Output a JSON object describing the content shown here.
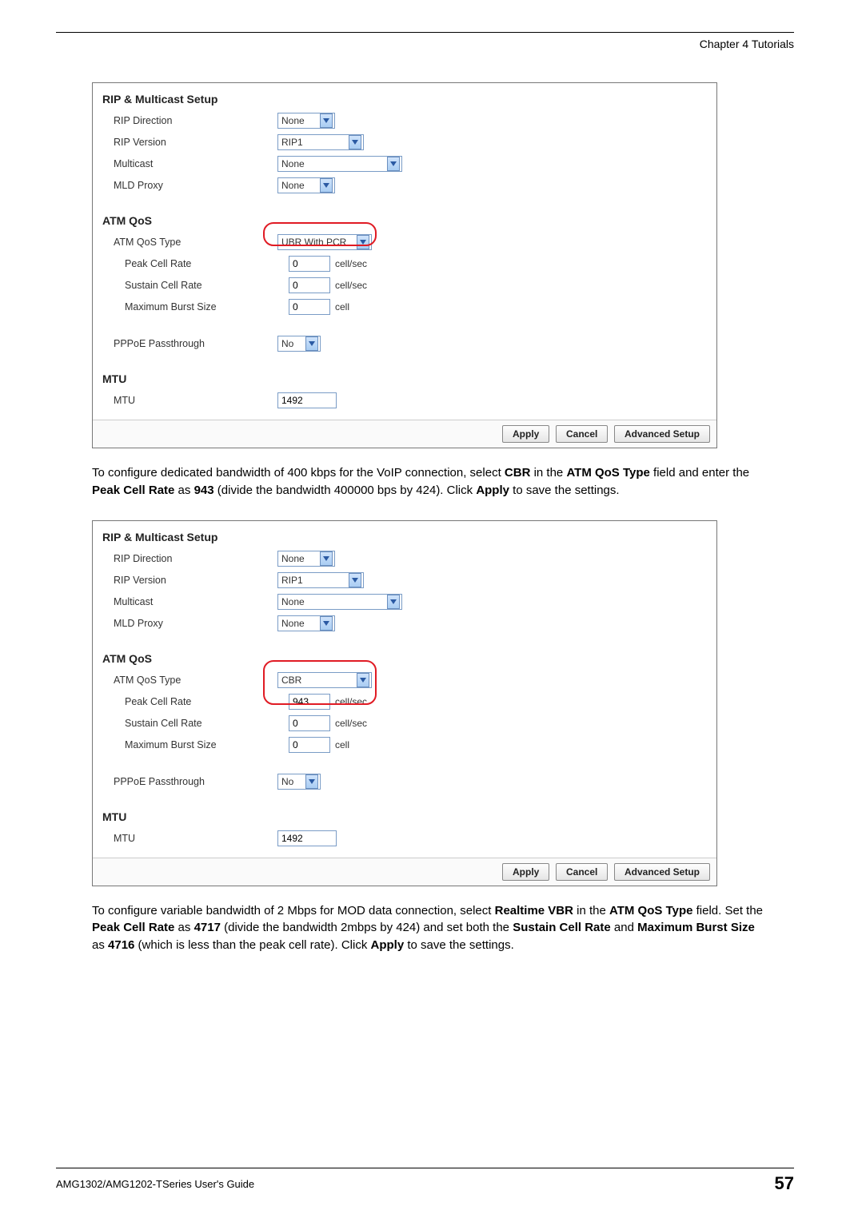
{
  "header": {
    "chapter": "Chapter 4 Tutorials"
  },
  "panel1": {
    "sectionA": "RIP & Multicast Setup",
    "ripDirection": {
      "label": "RIP Direction",
      "value": "None"
    },
    "ripVersion": {
      "label": "RIP Version",
      "value": "RIP1"
    },
    "multicast": {
      "label": "Multicast",
      "value": "None"
    },
    "mldProxy": {
      "label": "MLD Proxy",
      "value": "None"
    },
    "sectionB": "ATM QoS",
    "atmQosType": {
      "label": "ATM QoS Type",
      "value": "UBR With PCR"
    },
    "peak": {
      "label": "Peak Cell Rate",
      "value": "0",
      "unit": "cell/sec"
    },
    "sustain": {
      "label": "Sustain Cell Rate",
      "value": "0",
      "unit": "cell/sec"
    },
    "burst": {
      "label": "Maximum Burst Size",
      "value": "0",
      "unit": "cell"
    },
    "pppoe": {
      "label": "PPPoE Passthrough",
      "value": "No"
    },
    "sectionC": "MTU",
    "mtu": {
      "label": "MTU",
      "value": "1492"
    },
    "buttons": {
      "apply": "Apply",
      "cancel": "Cancel",
      "advanced": "Advanced Setup"
    }
  },
  "para1": {
    "t1": "To configure dedicated bandwidth of 400 kbps for the VoIP connection, select ",
    "b1": "CBR",
    "t2": " in the ",
    "b2": "ATM QoS Type",
    "t3": " field and enter the ",
    "b3": "Peak Cell Rate",
    "t4": " as ",
    "b4": "943",
    "t5": " (divide the bandwidth 400000 bps by 424). Click ",
    "b5": "Apply",
    "t6": " to save the settings."
  },
  "panel2": {
    "sectionA": "RIP & Multicast Setup",
    "ripDirection": {
      "label": "RIP Direction",
      "value": "None"
    },
    "ripVersion": {
      "label": "RIP Version",
      "value": "RIP1"
    },
    "multicast": {
      "label": "Multicast",
      "value": "None"
    },
    "mldProxy": {
      "label": "MLD Proxy",
      "value": "None"
    },
    "sectionB": "ATM QoS",
    "atmQosType": {
      "label": "ATM QoS Type",
      "value": "CBR"
    },
    "peak": {
      "label": "Peak Cell Rate",
      "value": "943",
      "unit": "cell/sec"
    },
    "sustain": {
      "label": "Sustain Cell Rate",
      "value": "0",
      "unit": "cell/sec"
    },
    "burst": {
      "label": "Maximum Burst Size",
      "value": "0",
      "unit": "cell"
    },
    "pppoe": {
      "label": "PPPoE Passthrough",
      "value": "No"
    },
    "sectionC": "MTU",
    "mtu": {
      "label": "MTU",
      "value": "1492"
    },
    "buttons": {
      "apply": "Apply",
      "cancel": "Cancel",
      "advanced": "Advanced Setup"
    }
  },
  "para2": {
    "t1": "To configure variable bandwidth of 2 Mbps for MOD data connection, select ",
    "b1": "Realtime VBR",
    "t2": " in the ",
    "b2": "ATM QoS Type",
    "t3": " field. Set the ",
    "b3": "Peak Cell Rate",
    "t4": " as ",
    "b4": "4717",
    "t5": " (divide the bandwidth 2mbps by 424) and set both the ",
    "b5": "Sustain Cell Rate",
    "t6": " and ",
    "b6": "Maximum Burst Size",
    "t7": " as ",
    "b7": "4716",
    "t8": " (which is less than the peak cell rate). Click ",
    "b8": "Apply",
    "t9": " to save the settings."
  },
  "footer": {
    "guide": "AMG1302/AMG1202-TSeries User's Guide",
    "page": "57"
  }
}
